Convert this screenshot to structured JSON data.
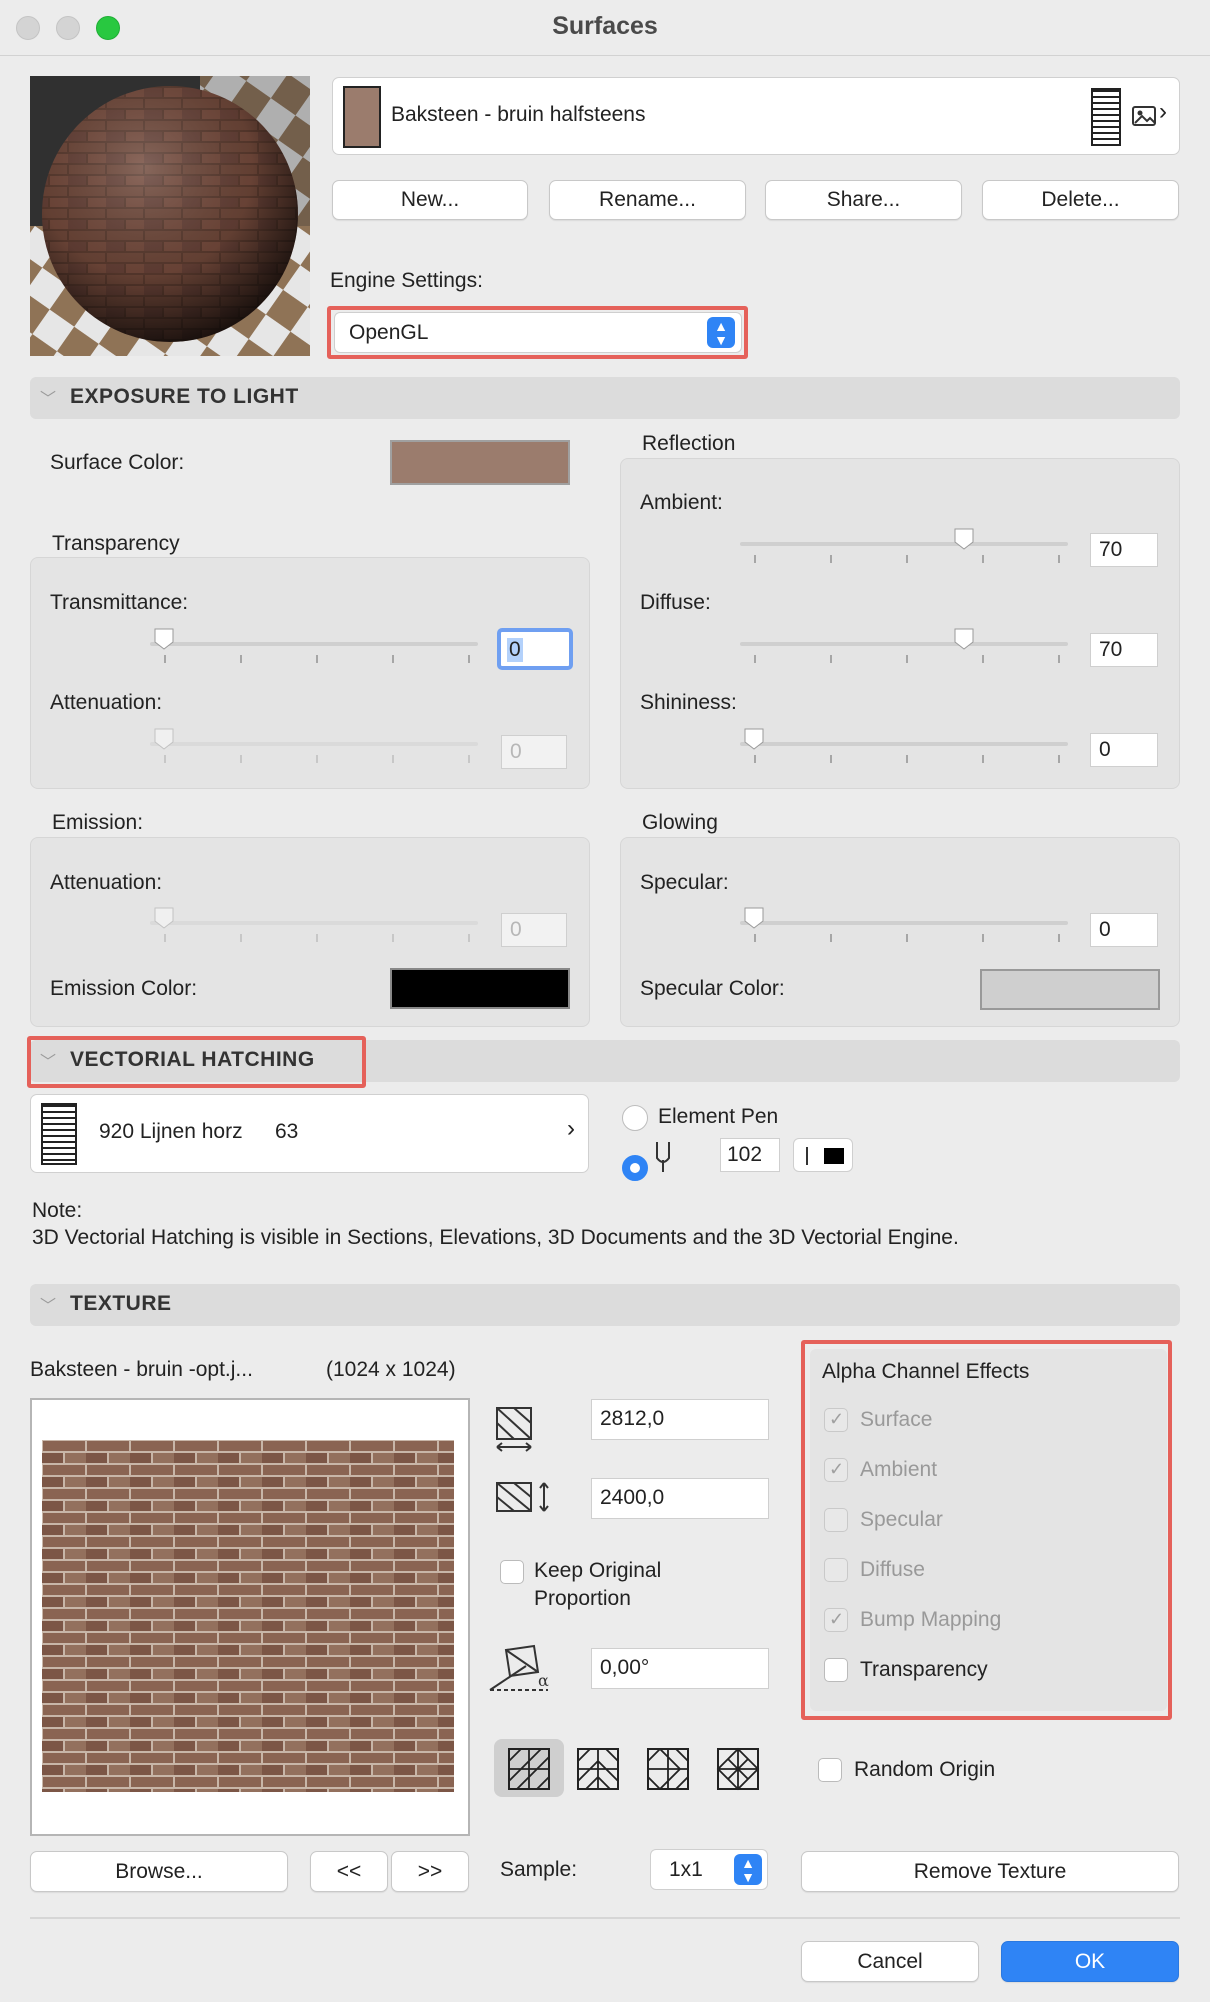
{
  "window": {
    "title": "Surfaces"
  },
  "header": {
    "surface_name": "Baksteen - bruin halfsteens",
    "buttons": {
      "new": "New...",
      "rename": "Rename...",
      "share": "Share...",
      "delete": "Delete..."
    },
    "engine_label": "Engine Settings:",
    "engine_value": "OpenGL"
  },
  "exposure": {
    "title": "EXPOSURE TO LIGHT",
    "surface_color_label": "Surface Color:",
    "surface_color": "#9b7c6d",
    "transparency": {
      "title": "Transparency",
      "transmittance_label": "Transmittance:",
      "transmittance": "0",
      "attenuation_label": "Attenuation:",
      "attenuation": "0"
    },
    "reflection": {
      "title": "Reflection",
      "ambient_label": "Ambient:",
      "ambient": "70",
      "diffuse_label": "Diffuse:",
      "diffuse": "70",
      "shininess_label": "Shininess:",
      "shininess": "0"
    },
    "emission": {
      "title": "Emission:",
      "attenuation_label": "Attenuation:",
      "attenuation": "0",
      "color_label": "Emission Color:",
      "color": "#000000"
    },
    "glowing": {
      "title": "Glowing",
      "specular_label": "Specular:",
      "specular": "0",
      "color_label": "Specular Color:",
      "color": "#cfcfcf"
    }
  },
  "hatching": {
    "title": "VECTORIAL HATCHING",
    "pattern_name": "920 Lijnen horz",
    "pattern_number": "63",
    "element_pen_label": "Element Pen",
    "pen_value": "102",
    "note_title": "Note:",
    "note_text": "3D Vectorial Hatching is visible in Sections, Elevations, 3D Documents and the 3D Vectorial Engine."
  },
  "texture": {
    "title": "TEXTURE",
    "file_name": "Baksteen - bruin -opt.j...",
    "file_size": "(1024 x 1024)",
    "width": "2812,0",
    "height": "2400,0",
    "keep_proportion_label": "Keep Original Proportion",
    "keep_proportion_line1": "Keep Original",
    "keep_proportion_line2": "Proportion",
    "angle": "0,00°",
    "alpha_title": "Alpha Channel Effects",
    "alpha_options": [
      {
        "label": "Surface",
        "checked": true
      },
      {
        "label": "Ambient",
        "checked": true
      },
      {
        "label": "Specular",
        "checked": false
      },
      {
        "label": "Diffuse",
        "checked": false
      },
      {
        "label": "Bump Mapping",
        "checked": true
      },
      {
        "label": "Transparency",
        "checked": false
      }
    ],
    "random_origin_label": "Random Origin",
    "browse_label": "Browse...",
    "prev_label": "<<",
    "next_label": ">>",
    "sample_label": "Sample:",
    "sample_value": "1x1",
    "remove_label": "Remove Texture"
  },
  "footer": {
    "cancel_label": "Cancel",
    "ok_label": "OK"
  },
  "colors": {
    "accent": "#2f84f5",
    "highlight": "#e5615a"
  }
}
